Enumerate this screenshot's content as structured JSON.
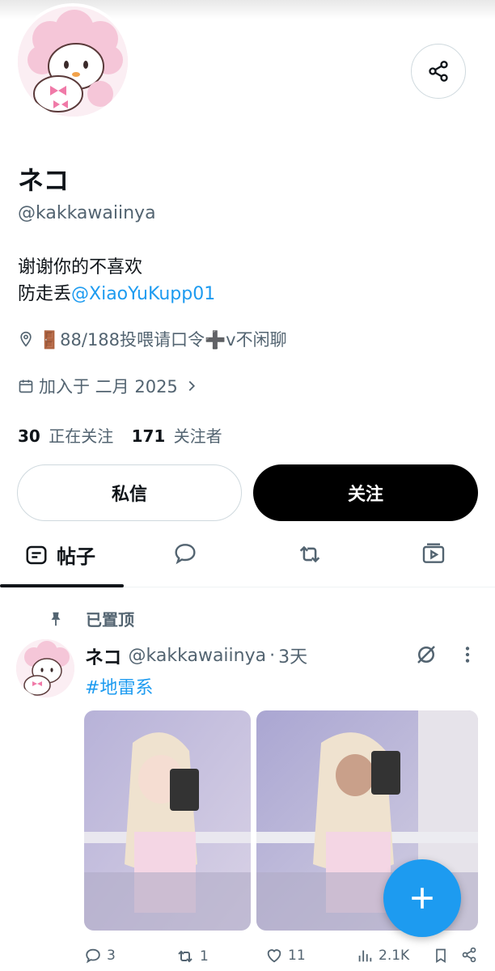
{
  "profile": {
    "display_name": "ネコ",
    "handle": "@kakkawaiinya",
    "bio_line1": "谢谢你的不喜欢",
    "bio_line2_prefix": "防走丢",
    "bio_mention": "@XiaoYuKupp01",
    "location": "🚪88/188投喂请口令➕v不闲聊",
    "joined": "加入于 二月 2025",
    "following_count": "30",
    "following_label": "正在关注",
    "followers_count": "171",
    "followers_label": "关注者"
  },
  "buttons": {
    "dm_label": "私信",
    "follow_label": "关注"
  },
  "tabs": {
    "posts_label": "帖子"
  },
  "post": {
    "pinned_label": "已置顶",
    "author": "ネコ",
    "handle": "@kakkawaiinya",
    "separator": "·",
    "time": "3天",
    "hashtag": "#地雷系",
    "replies": "3",
    "reposts": "1",
    "likes": "11",
    "views": "2.1K"
  },
  "icons": {
    "share": "share-icon",
    "location": "location-pin-icon",
    "calendar": "calendar-icon",
    "chevron": "chevron-right-icon",
    "posts_tab": "posts-tab-icon",
    "replies_tab": "speech-bubble-icon",
    "reposts_tab": "repost-icon",
    "media_tab": "media-icon",
    "pin": "pin-icon",
    "grok": "grok-icon",
    "more": "more-vertical-icon",
    "compose": "plus-icon",
    "reply": "reply-icon",
    "repost": "repost-icon",
    "like": "heart-icon",
    "views": "views-icon",
    "bookmark": "bookmark-icon",
    "post_share": "share-icon"
  },
  "colors": {
    "accent": "#1d9bf0",
    "text": "#0f1419",
    "muted": "#536471",
    "follow_button": "#000000"
  }
}
